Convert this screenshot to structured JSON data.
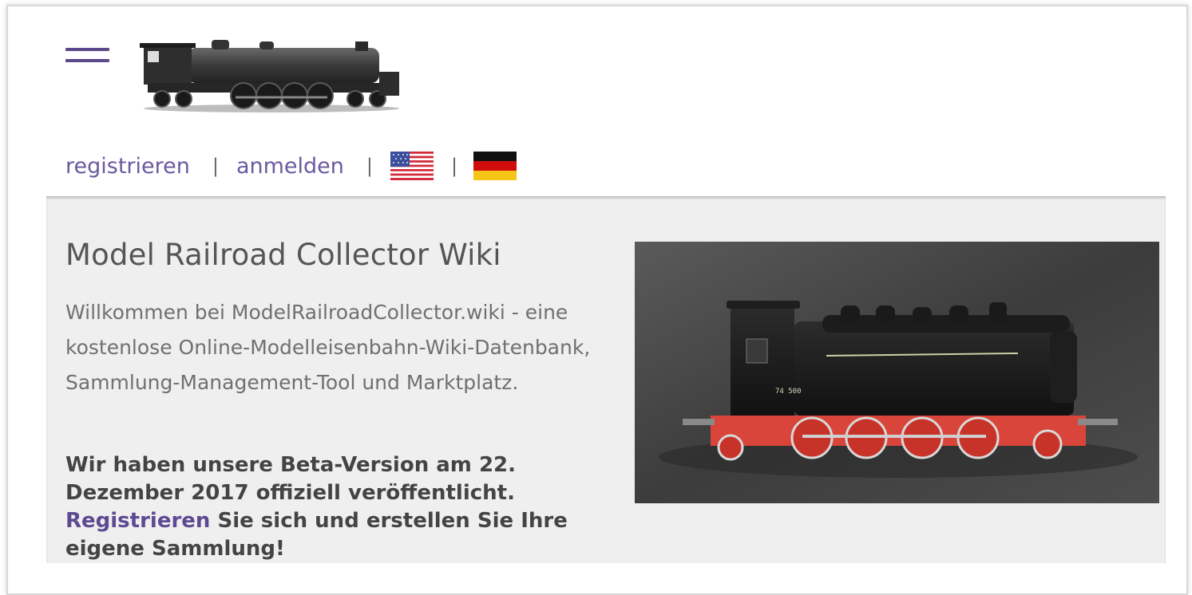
{
  "nav": {
    "register_label": "registrieren",
    "login_label": "anmelden",
    "separator": "|",
    "languages": [
      {
        "code": "en",
        "icon": "us-flag-icon"
      },
      {
        "code": "de",
        "icon": "german-flag-icon"
      }
    ]
  },
  "hero": {
    "title": "Model Railroad Collector Wiki",
    "intro": "Willkommen bei ModelRailroadCollector.wiki - eine kostenlose Online-Modelleisenbahn-Wiki-Datenbank, Sammlung-Management-Tool und Marktplatz.",
    "beta_prefix": "Wir haben unsere Beta-Version am 22. Dezember 2017 offiziell veröffentlicht.",
    "beta_link": "Registrieren",
    "beta_suffix": "Sie sich und erstellen Sie Ihre eigene Sammlung!"
  },
  "colors": {
    "accent": "#5e4c92",
    "hero_bg": "#efefef"
  }
}
